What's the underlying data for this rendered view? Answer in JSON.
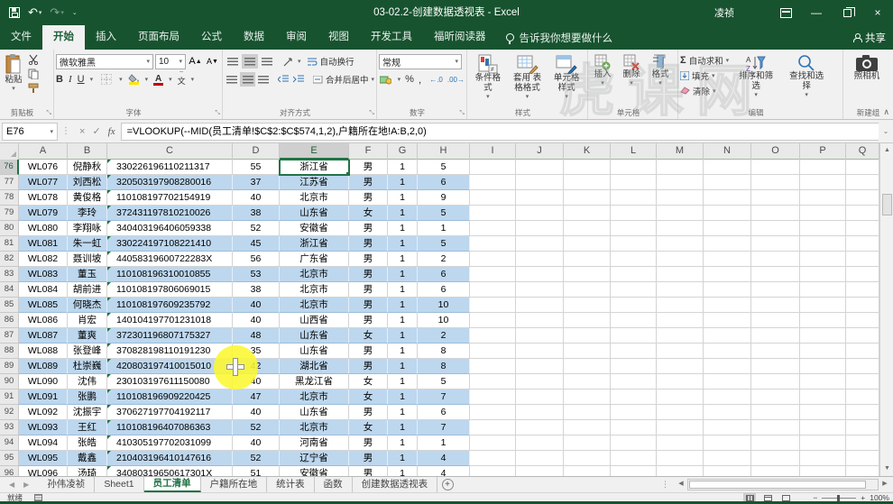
{
  "titlebar": {
    "title": "03-02.2-创建数据透视表 - Excel",
    "user": "凌祯"
  },
  "menubar": {
    "tabs": [
      "文件",
      "开始",
      "插入",
      "页面布局",
      "公式",
      "数据",
      "审阅",
      "视图",
      "开发工具",
      "福昕阅读器"
    ],
    "active": "开始",
    "tell_me": "告诉我你想要做什么",
    "share": "共享"
  },
  "ribbon": {
    "clipboard": {
      "label": "剪贴板",
      "paste": "粘贴"
    },
    "font": {
      "label": "字体",
      "name": "微软雅黑",
      "size": "10",
      "bold": "B",
      "italic": "I",
      "underline": "U",
      "grow": "A",
      "shrink": "A",
      "phonetic": "文"
    },
    "alignment": {
      "label": "对齐方式",
      "wrap": "自动换行",
      "merge": "合并后居中",
      "orient": "ab"
    },
    "number": {
      "label": "数字",
      "format": "常规",
      "percent": "%",
      "comma": ",",
      "dec_inc": "←.0",
      "dec_dec": ".00→"
    },
    "styles": {
      "label": "样式",
      "conditional": "条件格式",
      "table": "套用 表格格式",
      "cell": "单元格样式"
    },
    "cells": {
      "label": "单元格",
      "insert": "插入",
      "delete": "删除",
      "format": "格式"
    },
    "editing": {
      "label": "编辑",
      "autosum": "自动求和",
      "fill": "填充",
      "clear": "清除",
      "sort": "排序和筛选",
      "find": "查找和选择"
    },
    "newgroup": {
      "label": "新建组",
      "camera": "照相机"
    }
  },
  "formula_bar": {
    "name_box": "E76",
    "formula": "=VLOOKUP(--MID(员工清单!$C$2:$C$574,1,2),户籍所在地!A:B,2,0)"
  },
  "grid": {
    "columns": [
      "A",
      "B",
      "C",
      "D",
      "E",
      "F",
      "G",
      "H",
      "I",
      "J",
      "K",
      "L",
      "M",
      "N",
      "O",
      "P",
      "Q"
    ],
    "selected_cell": "E76",
    "selected_column": "E",
    "selected_row": 76,
    "rows": [
      {
        "num": 76,
        "cells": [
          "WL076",
          "倪静秋",
          "330226196110211317",
          "55",
          "浙江省",
          "男",
          "1",
          "5"
        ]
      },
      {
        "num": 77,
        "cells": [
          "WL077",
          "刘西松",
          "320503197908280016",
          "37",
          "江苏省",
          "男",
          "1",
          "6"
        ]
      },
      {
        "num": 78,
        "cells": [
          "WL078",
          "黄俊格",
          "110108197702154919",
          "40",
          "北京市",
          "男",
          "1",
          "9"
        ]
      },
      {
        "num": 79,
        "cells": [
          "WL079",
          "李玲",
          "372431197810210026",
          "38",
          "山东省",
          "女",
          "1",
          "5"
        ]
      },
      {
        "num": 80,
        "cells": [
          "WL080",
          "李翔咏",
          "340403196406059338",
          "52",
          "安徽省",
          "男",
          "1",
          "1"
        ]
      },
      {
        "num": 81,
        "cells": [
          "WL081",
          "朱一虹",
          "330224197108221410",
          "45",
          "浙江省",
          "男",
          "1",
          "5"
        ]
      },
      {
        "num": 82,
        "cells": [
          "WL082",
          "聂训坡",
          "44058319600722283X",
          "56",
          "广东省",
          "男",
          "1",
          "2"
        ]
      },
      {
        "num": 83,
        "cells": [
          "WL083",
          "董玉",
          "110108196310010855",
          "53",
          "北京市",
          "男",
          "1",
          "6"
        ]
      },
      {
        "num": 84,
        "cells": [
          "WL084",
          "胡前进",
          "110108197806069015",
          "38",
          "北京市",
          "男",
          "1",
          "6"
        ]
      },
      {
        "num": 85,
        "cells": [
          "WL085",
          "何晓杰",
          "110108197609235792",
          "40",
          "北京市",
          "男",
          "1",
          "10"
        ]
      },
      {
        "num": 86,
        "cells": [
          "WL086",
          "肖宏",
          "140104197701231018",
          "40",
          "山西省",
          "男",
          "1",
          "10"
        ]
      },
      {
        "num": 87,
        "cells": [
          "WL087",
          "董爽",
          "372301196807175327",
          "48",
          "山东省",
          "女",
          "1",
          "2"
        ]
      },
      {
        "num": 88,
        "cells": [
          "WL088",
          "张登峰",
          "370828198110191230",
          "35",
          "山东省",
          "男",
          "1",
          "8"
        ]
      },
      {
        "num": 89,
        "cells": [
          "WL089",
          "杜崇巍",
          "420803197410015010",
          "42",
          "湖北省",
          "男",
          "1",
          "8"
        ]
      },
      {
        "num": 90,
        "cells": [
          "WL090",
          "沈伟",
          "230103197611150080",
          "40",
          "黑龙江省",
          "女",
          "1",
          "5"
        ]
      },
      {
        "num": 91,
        "cells": [
          "WL091",
          "张鹏",
          "110108196909220425",
          "47",
          "北京市",
          "女",
          "1",
          "7"
        ]
      },
      {
        "num": 92,
        "cells": [
          "WL092",
          "沈振宇",
          "370627197704192117",
          "40",
          "山东省",
          "男",
          "1",
          "6"
        ]
      },
      {
        "num": 93,
        "cells": [
          "WL093",
          "王红",
          "110108196407086363",
          "52",
          "北京市",
          "女",
          "1",
          "7"
        ]
      },
      {
        "num": 94,
        "cells": [
          "WL094",
          "张皓",
          "410305197702031099",
          "40",
          "河南省",
          "男",
          "1",
          "1"
        ]
      },
      {
        "num": 95,
        "cells": [
          "WL095",
          "戴鑫",
          "210403196410147616",
          "52",
          "辽宁省",
          "男",
          "1",
          "4"
        ]
      },
      {
        "num": 96,
        "cells": [
          "WL096",
          "汤琦",
          "34080319650617301X",
          "51",
          "安徽省",
          "男",
          "1",
          "4"
        ]
      }
    ]
  },
  "sheet_tabs": {
    "tabs": [
      "孙伟凌祯",
      "Sheet1",
      "员工清单",
      "户籍所在地",
      "统计表",
      "函数",
      "创建数据透视表"
    ],
    "active": "员工清单"
  },
  "status_bar": {
    "ready": "就绪",
    "zoom": "100%"
  },
  "watermark": {
    "text": "虎课网"
  },
  "icons": {
    "dropdown": "▾",
    "up": "▲",
    "down": "▼",
    "left": "◀",
    "right": "▶",
    "close": "×",
    "minimize": "—",
    "check": "✓",
    "cancel": "×",
    "fx": "fx",
    "sigma": "Σ",
    "dots": "⋮",
    "add": "+",
    "collapse": "∧",
    "select_all": "◢",
    "undo": "↶",
    "redo": "↷",
    "expand": "⌄"
  },
  "colors": {
    "excel_green": "#217346",
    "titlebar_green": "#17532f",
    "band_blue": "#bdd7ee",
    "highlight_yellow": "#fcf730",
    "fill_color_bar": "#ffe400",
    "font_color_bar": "#c00000"
  }
}
